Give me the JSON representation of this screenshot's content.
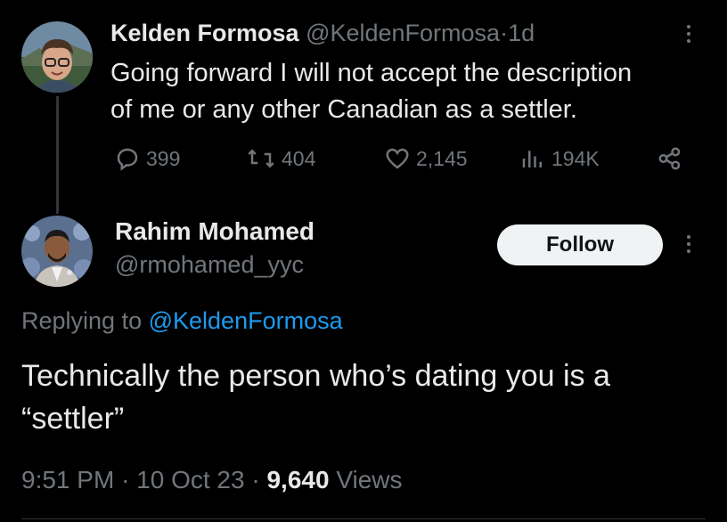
{
  "tweet": {
    "author_name": "Kelden Formosa",
    "author_handle": "@KeldenFormosa",
    "separator": "·",
    "age": "1d",
    "text_line1": "Going forward I will not accept the description",
    "text_line2": "of me or any other Canadian as a settler.",
    "replies": "399",
    "reposts": "404",
    "likes": "2,145",
    "views": "194K"
  },
  "reply": {
    "author_name": "Rahim Mohamed",
    "author_handle": "@rmohamed_yyc",
    "follow_label": "Follow",
    "replying_to_prefix": "Replying to",
    "replying_to_handle": "@KeldenFormosa",
    "text_line1": "Technically the person who’s dating you is a",
    "text_line2": "“settler”",
    "time": "9:51 PM",
    "dot1": "·",
    "date": "10 Oct 23",
    "dot2": "·",
    "view_count": "9,640",
    "views_label": "Views"
  },
  "colors": {
    "background": "#000000",
    "text": "#e7e9ea",
    "muted": "#71767b",
    "link": "#1d9bf0",
    "follow_button": "#eff3f4"
  },
  "icons": [
    "reply-icon",
    "repost-icon",
    "like-icon",
    "views-icon",
    "share-icon",
    "more-icon"
  ]
}
